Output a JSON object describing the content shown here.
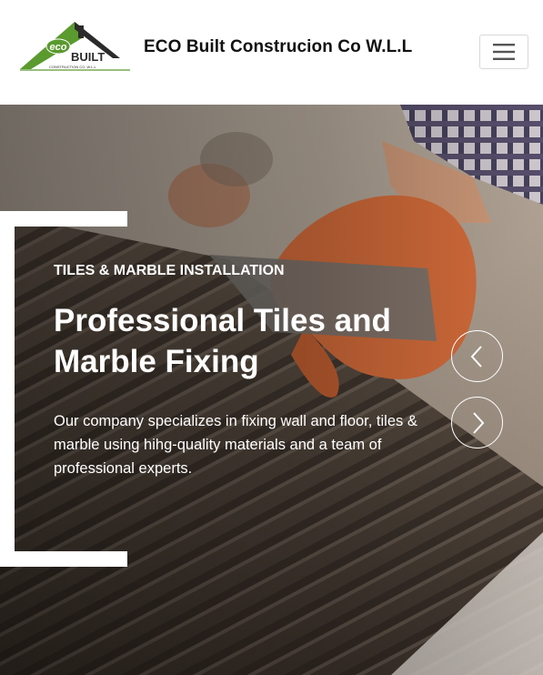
{
  "header": {
    "logo": {
      "word_eco": "eco",
      "word_built": "BUILT",
      "tagline": "CONSTRUCTION CO. W.L.L",
      "colors": {
        "green": "#5a9a2e",
        "dark": "#2b2b2b"
      }
    },
    "title": "ECO Built Construcion Co W.L.L",
    "menu_icon": "hamburger-icon"
  },
  "hero": {
    "kicker": "TILES & MARBLE INSTALLATION",
    "heading": "Professional Tiles and Marble Fixing",
    "text": "Our company specializes in fixing wall and floor, tiles & marble using hihg-quality materials and a team of professional experts.",
    "prev_icon": "chevron-left-icon",
    "next_icon": "chevron-right-icon"
  }
}
